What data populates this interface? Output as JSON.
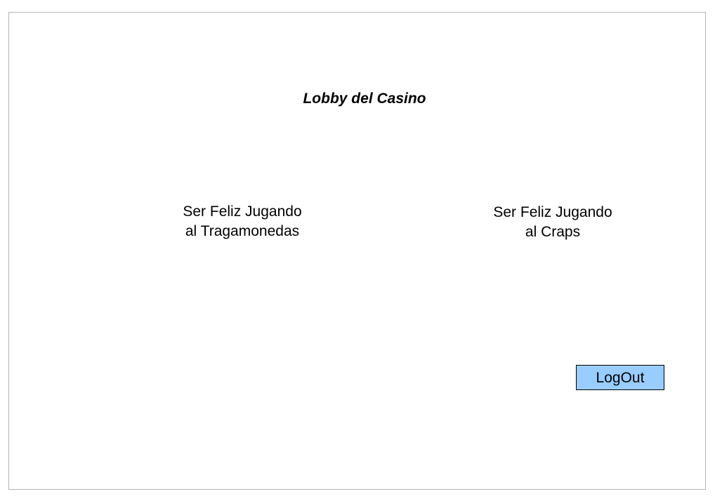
{
  "lobby": {
    "title": "Lobby del Casino",
    "games": {
      "slots": {
        "line1": "Ser Feliz Jugando",
        "line2": "al Tragamonedas"
      },
      "craps": {
        "line1": "Ser Feliz Jugando",
        "line2": "al Craps"
      }
    },
    "logout_label": "LogOut"
  },
  "colors": {
    "logout_button_bg": "#99ccff",
    "frame_border": "#b4b4b4"
  }
}
